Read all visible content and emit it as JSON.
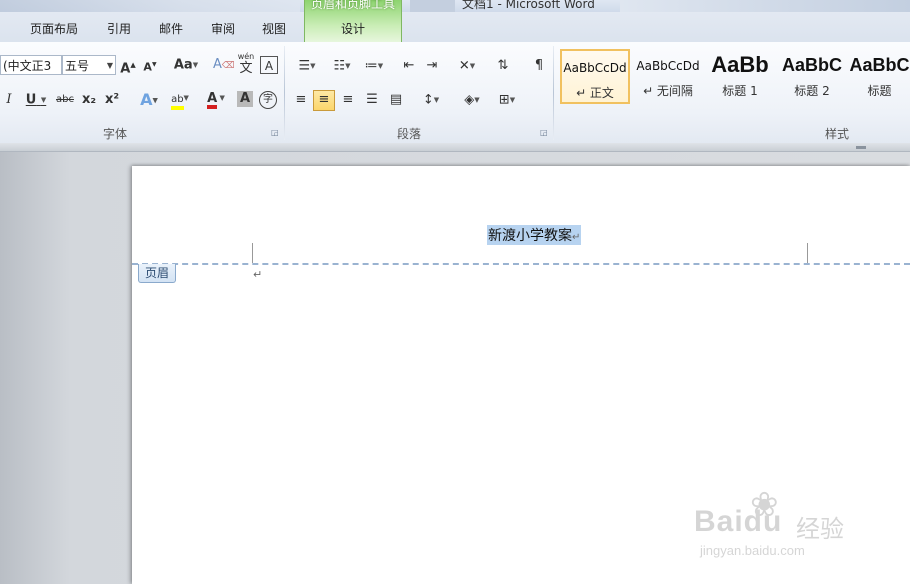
{
  "window": {
    "doc_title": "文档1 - Microsoft Word",
    "contextual_tab_group": "页眉和页脚工具"
  },
  "tabs": [
    {
      "label": "页面布局"
    },
    {
      "label": "引用"
    },
    {
      "label": "邮件"
    },
    {
      "label": "审阅"
    },
    {
      "label": "视图"
    },
    {
      "label": "设计"
    }
  ],
  "ribbon": {
    "font_group": {
      "label": "字体",
      "font_name": "(中文正3",
      "font_size": "五号",
      "grow_icon": "A",
      "shrink_icon": "A",
      "case_icon": "Aa",
      "clear_icon": "A",
      "phonetic_icon": "wén",
      "phonetic_char": "文",
      "border_char_icon": "A",
      "italic_icon": "I",
      "underline_icon": "U",
      "strike_icon": "abc",
      "subscript_icon": "x₂",
      "superscript_icon": "x²",
      "effects_icon": "A",
      "highlight_icon": "ab",
      "font_color_icon": "A",
      "shading_icon": "A",
      "enclose_icon": "字"
    },
    "paragraph_group": {
      "label": "段落"
    },
    "styles_group": {
      "label": "样式",
      "items": [
        {
          "sample": "AaBbCcDd",
          "name": "↵ 正文"
        },
        {
          "sample": "AaBbCcDd",
          "name": "↵ 无间隔"
        },
        {
          "sample": "AaBb",
          "name": "标题 1"
        },
        {
          "sample": "AaBbC",
          "name": "标题 2"
        },
        {
          "sample": "AaBbC",
          "name": "标题"
        }
      ]
    }
  },
  "document": {
    "header_text": "新渡小学教案",
    "header_para_mark": "↵",
    "header_tag": "页眉",
    "body_para_mark": "↵"
  },
  "watermark": {
    "brand": "Baidu",
    "jingyan": "经验",
    "site": "jingyan.baidu.com"
  },
  "colors": {
    "selection": "#b7d3f0",
    "header_dashed_line": "#9ab3d1",
    "contextual_tab": "#8dd36f",
    "active_button": "#fcd66b",
    "font_color_red": "#d42020",
    "highlight_yellow": "#ffff00"
  }
}
